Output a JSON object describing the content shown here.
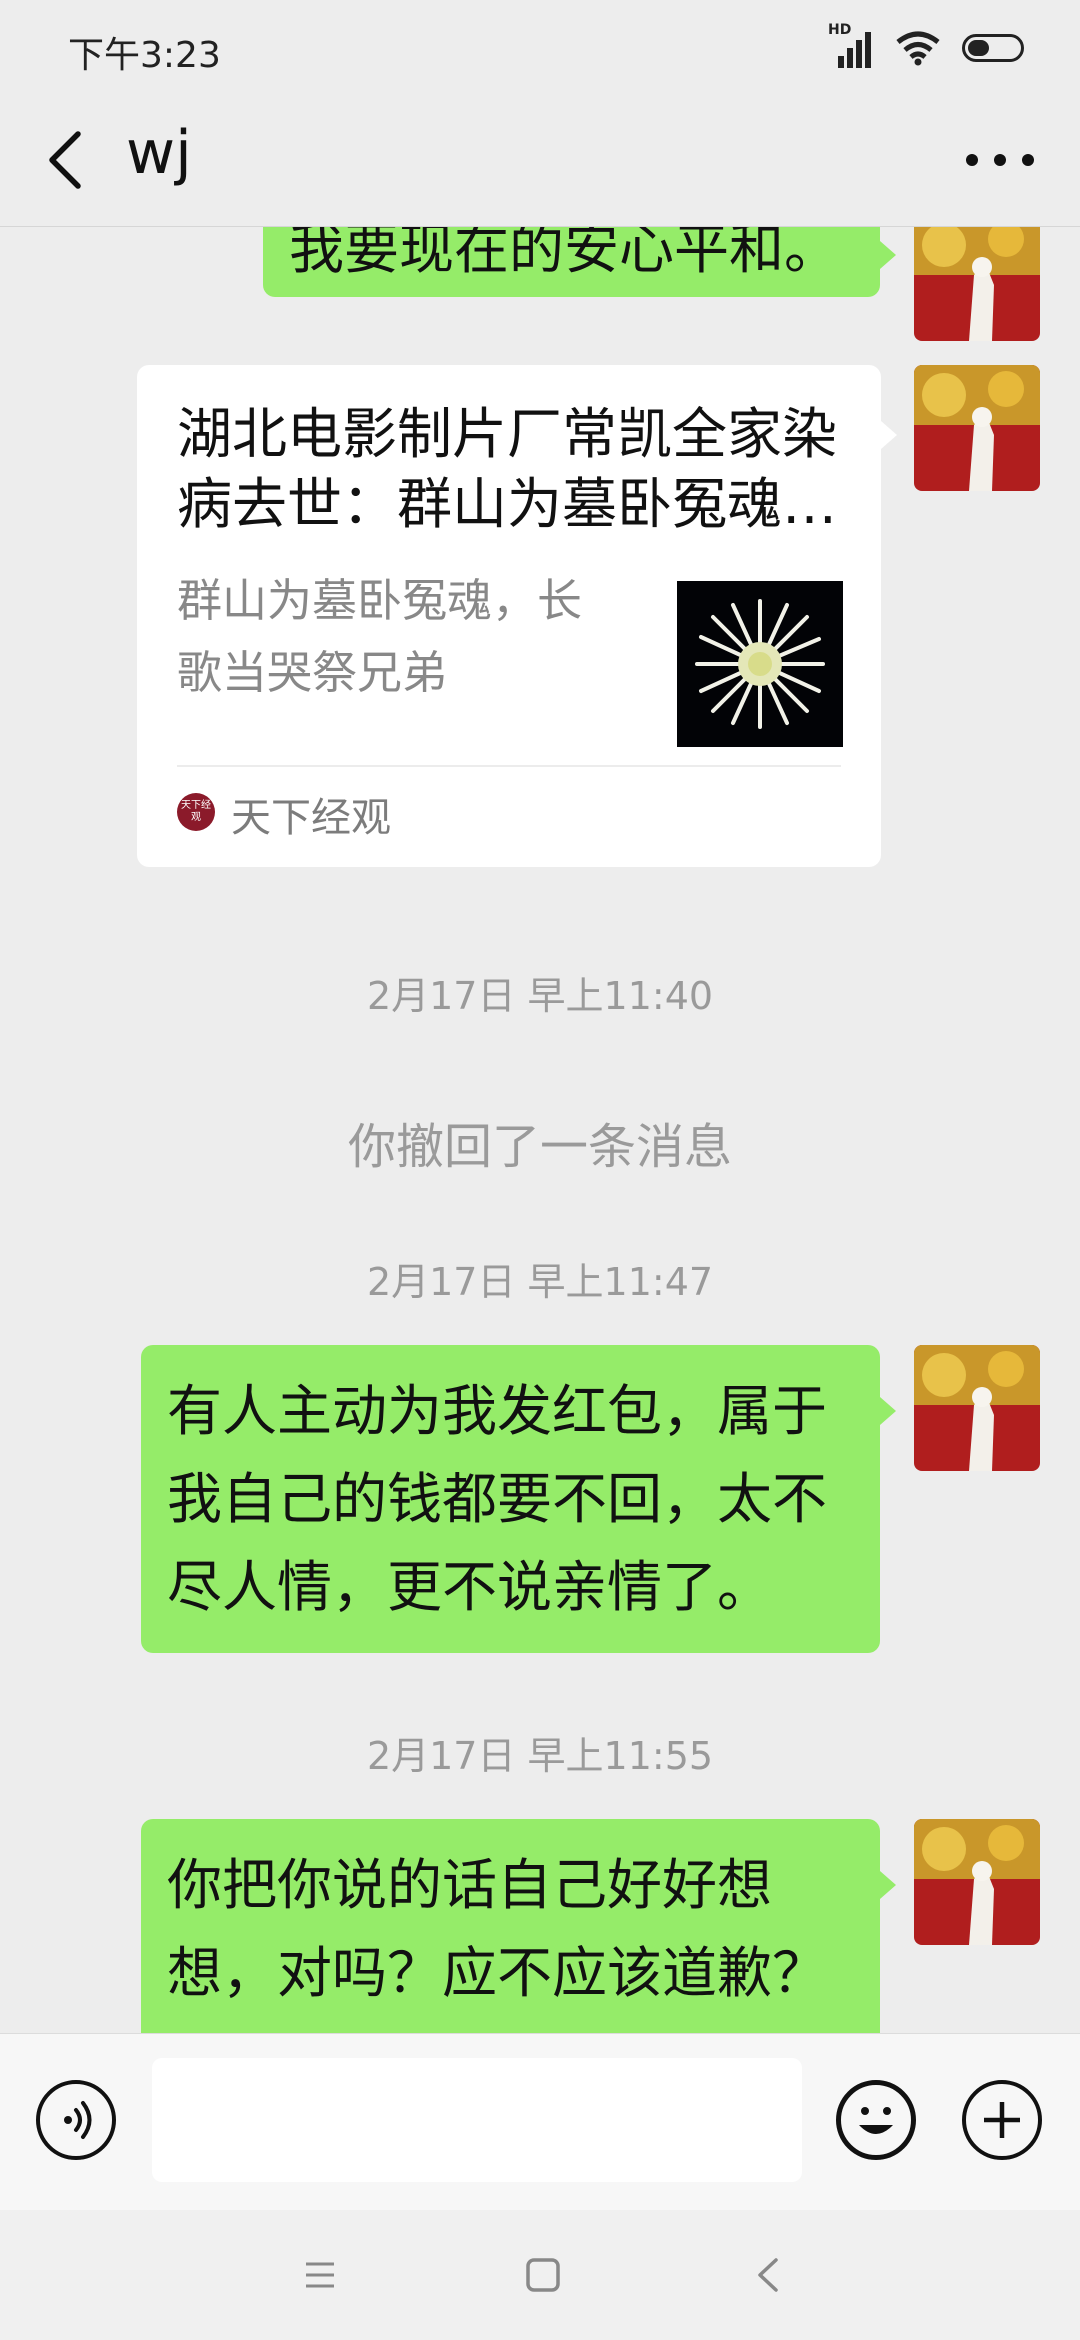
{
  "status_bar": {
    "time": "下午3:23",
    "network_label": "HD"
  },
  "header": {
    "title": "wj"
  },
  "messages": {
    "m1": {
      "text": "我要现在的安心平和。"
    },
    "card": {
      "title": "湖北电影制片厂常凯全家染病去世：群山为墓卧冤魂，长歌当哭祭兄弟",
      "description": "群山为墓卧冤魂，长歌当哭祭兄弟",
      "source_logo_text": "天下经观",
      "source_name": "天下经观"
    },
    "ts1": "2月17日 早上11:40",
    "recall": "你撤回了一条消息",
    "ts2": "2月17日 早上11:47",
    "m2": {
      "text": "有人主动为我发红包，属于我自己的钱都要不回，太不尽人情，更不说亲情了。"
    },
    "ts3": "2月17日 早上11:55",
    "m3": {
      "text": "你把你说的话自己好好想想，对吗？应不应该道歉？"
    }
  },
  "input_bar": {
    "value": "",
    "placeholder": ""
  },
  "icons": {
    "back": "back-chevron-icon",
    "more": "more-dots-icon",
    "voice": "voice-icon",
    "emoji": "emoji-icon",
    "add": "plus-icon",
    "nav_menu": "menu-icon",
    "nav_home": "home-square-icon",
    "nav_back": "back-triangle-icon"
  },
  "colors": {
    "bubble_self": "#95ec69",
    "background": "#ededed",
    "card_bg": "#ffffff"
  }
}
